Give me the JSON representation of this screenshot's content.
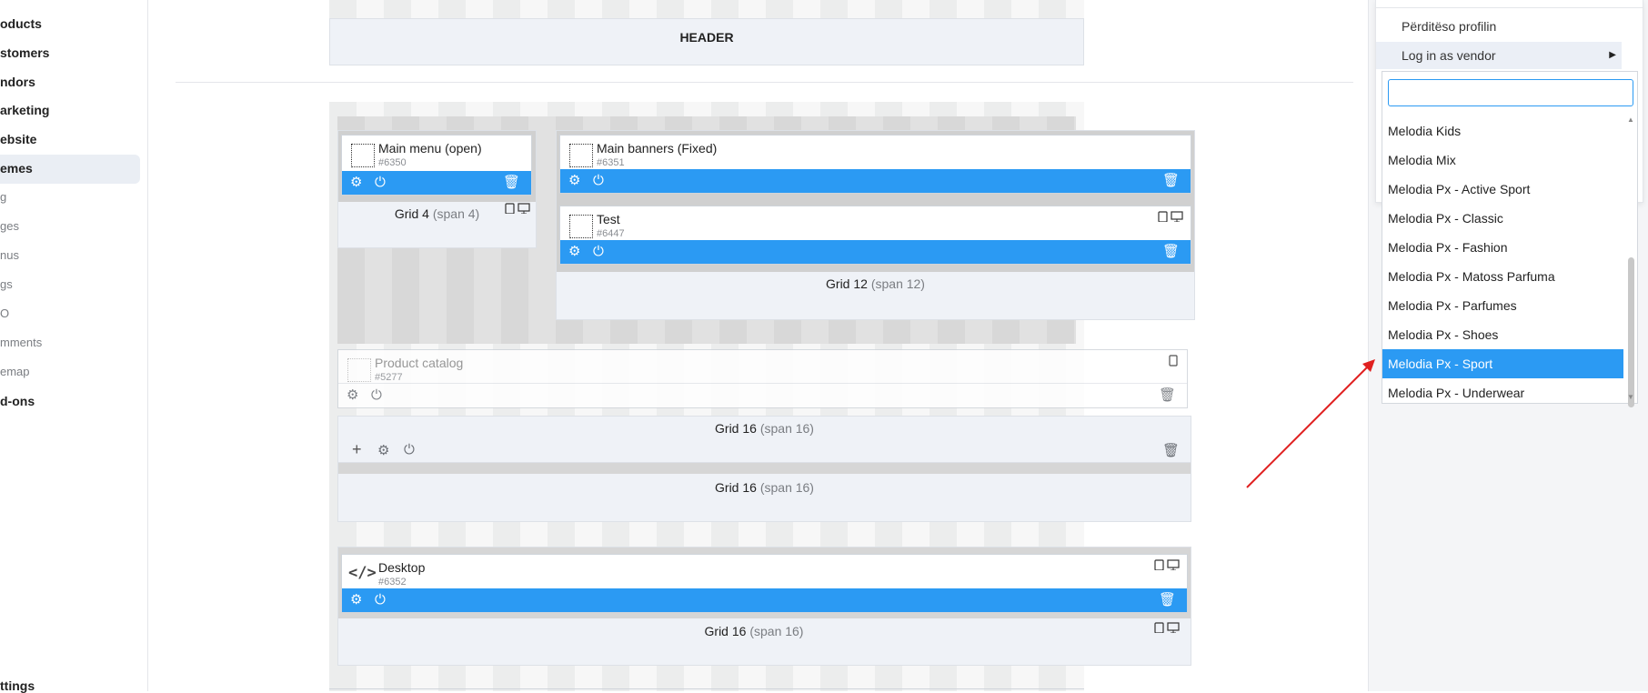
{
  "sidebar": {
    "items": [
      {
        "label": "oducts",
        "style": "bold"
      },
      {
        "label": "stomers",
        "style": "bold"
      },
      {
        "label": "ndors",
        "style": "bold"
      },
      {
        "label": "arketing",
        "style": "bold"
      },
      {
        "label": "ebsite",
        "style": "bold"
      },
      {
        "label": "emes",
        "style": "bold",
        "active": true
      },
      {
        "label": "g",
        "style": "sub"
      },
      {
        "label": "ges",
        "style": "sub"
      },
      {
        "label": "nus",
        "style": "sub"
      },
      {
        "label": "gs",
        "style": "sub"
      },
      {
        "label": "O",
        "style": "sub"
      },
      {
        "label": "mments",
        "style": "sub"
      },
      {
        "label": "emap",
        "style": "sub"
      },
      {
        "label": "d-ons",
        "style": "bold"
      }
    ],
    "footer": "ttings"
  },
  "layout": {
    "header_label": "HEADER",
    "grids": {
      "grid4": {
        "name": "Grid 4",
        "span": "(span 4)"
      },
      "grid12": {
        "name": "Grid 12",
        "span": "(span 12)"
      },
      "grid16a": {
        "name": "Grid 16",
        "span": "(span 16)"
      },
      "grid16b": {
        "name": "Grid 16",
        "span": "(span 16)"
      },
      "grid16c": {
        "name": "Grid 16",
        "span": "(span 16)"
      }
    },
    "blocks": {
      "main_menu": {
        "title": "Main menu (open)",
        "id": "#6350"
      },
      "main_banners": {
        "title": "Main banners (Fixed)",
        "id": "#6351"
      },
      "test": {
        "title": "Test",
        "id": "#6447"
      },
      "product_catalog": {
        "title": "Product catalog",
        "id": "#5277"
      },
      "desktop": {
        "title": "Desktop",
        "id": "#6352"
      }
    }
  },
  "account_menu": {
    "items": [
      {
        "label": "Përditëso profilin"
      },
      {
        "label": "Log in as vendor"
      }
    ],
    "search_value": "",
    "vendor_options": [
      "Melodia Kids",
      "Melodia Mix",
      "Melodia Px - Active Sport",
      "Melodia Px - Classic",
      "Melodia Px - Fashion",
      "Melodia Px - Matoss Parfuma",
      "Melodia Px - Parfumes",
      "Melodia Px - Shoes",
      "Melodia Px - Sport",
      "Melodia Px - Underwear"
    ],
    "selected_vendor": "Melodia Px - Sport"
  },
  "colors": {
    "accent": "#2b9af3",
    "annotation_arrow": "#e02020"
  }
}
